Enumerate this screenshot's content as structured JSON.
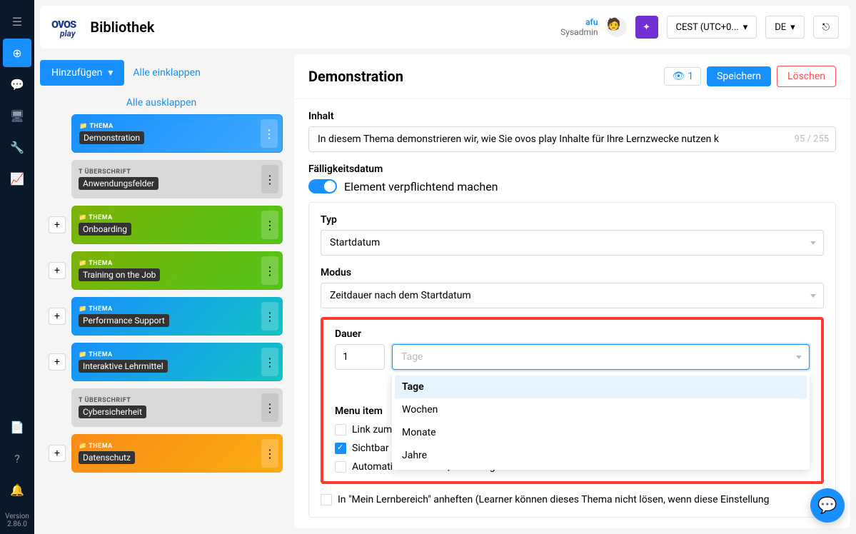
{
  "header": {
    "brand": "ovos",
    "brand_sub": "play",
    "page_title": "Bibliothek",
    "user_name": "afu",
    "user_role": "Sysadmin",
    "timezone": "CEST (UTC+0...",
    "language": "DE"
  },
  "sidebar_version": {
    "label": "Version",
    "value": "2.86.0"
  },
  "left": {
    "add_btn": "Hinzufügen",
    "collapse_all": "Alle einklappen",
    "expand_all": "Alle ausklappen",
    "items": [
      {
        "type": "THEMA",
        "label": "Demonstration",
        "selected": true,
        "icon": "folder"
      },
      {
        "type": "ÜBERSCHRIFT",
        "label": "Anwendungsfelder",
        "heading": true,
        "icon": "text"
      },
      {
        "type": "THEMA",
        "label": "Onboarding",
        "icon": "folder"
      },
      {
        "type": "THEMA",
        "label": "Training on the Job",
        "icon": "folder"
      },
      {
        "type": "THEMA",
        "label": "Performance Support",
        "icon": "folder"
      },
      {
        "type": "THEMA",
        "label": "Interaktive Lehrmittel",
        "icon": "folder"
      },
      {
        "type": "ÜBERSCHRIFT",
        "label": "Cybersicherheit",
        "heading": true,
        "icon": "text"
      },
      {
        "type": "THEMA",
        "label": "Datenschutz",
        "icon": "folder",
        "cls": "thema3"
      }
    ]
  },
  "right": {
    "title": "Demonstration",
    "views": "1",
    "save": "Speichern",
    "delete": "Löschen",
    "content_label": "Inhalt",
    "content_value": "In diesem Thema demonstrieren wir, wie Sie ovos play Inhalte für Ihre Lernzwecke nutzen k",
    "content_count": "95 / 255",
    "due_label": "Fälligkeitsdatum",
    "mandatory": "Element verpflichtend machen",
    "type_label": "Typ",
    "type_value": "Startdatum",
    "mode_label": "Modus",
    "mode_value": "Zeitdauer nach dem Startdatum",
    "duration_label": "Dauer",
    "duration_num": "1",
    "duration_unit_placeholder": "Tage",
    "duration_options": [
      "Tage",
      "Wochen",
      "Monate",
      "Jahre"
    ],
    "menu_item_label": "Menu item",
    "link_hub": "Link zum H",
    "visible": "Sichtbar",
    "auto_email": "Automatisierte E-Mail, wenn abgeschlossen",
    "pin_text": "In \"Mein Lernbereich\" anheften (Learner können dieses Thema nicht lösen, wenn diese Einstellung"
  }
}
